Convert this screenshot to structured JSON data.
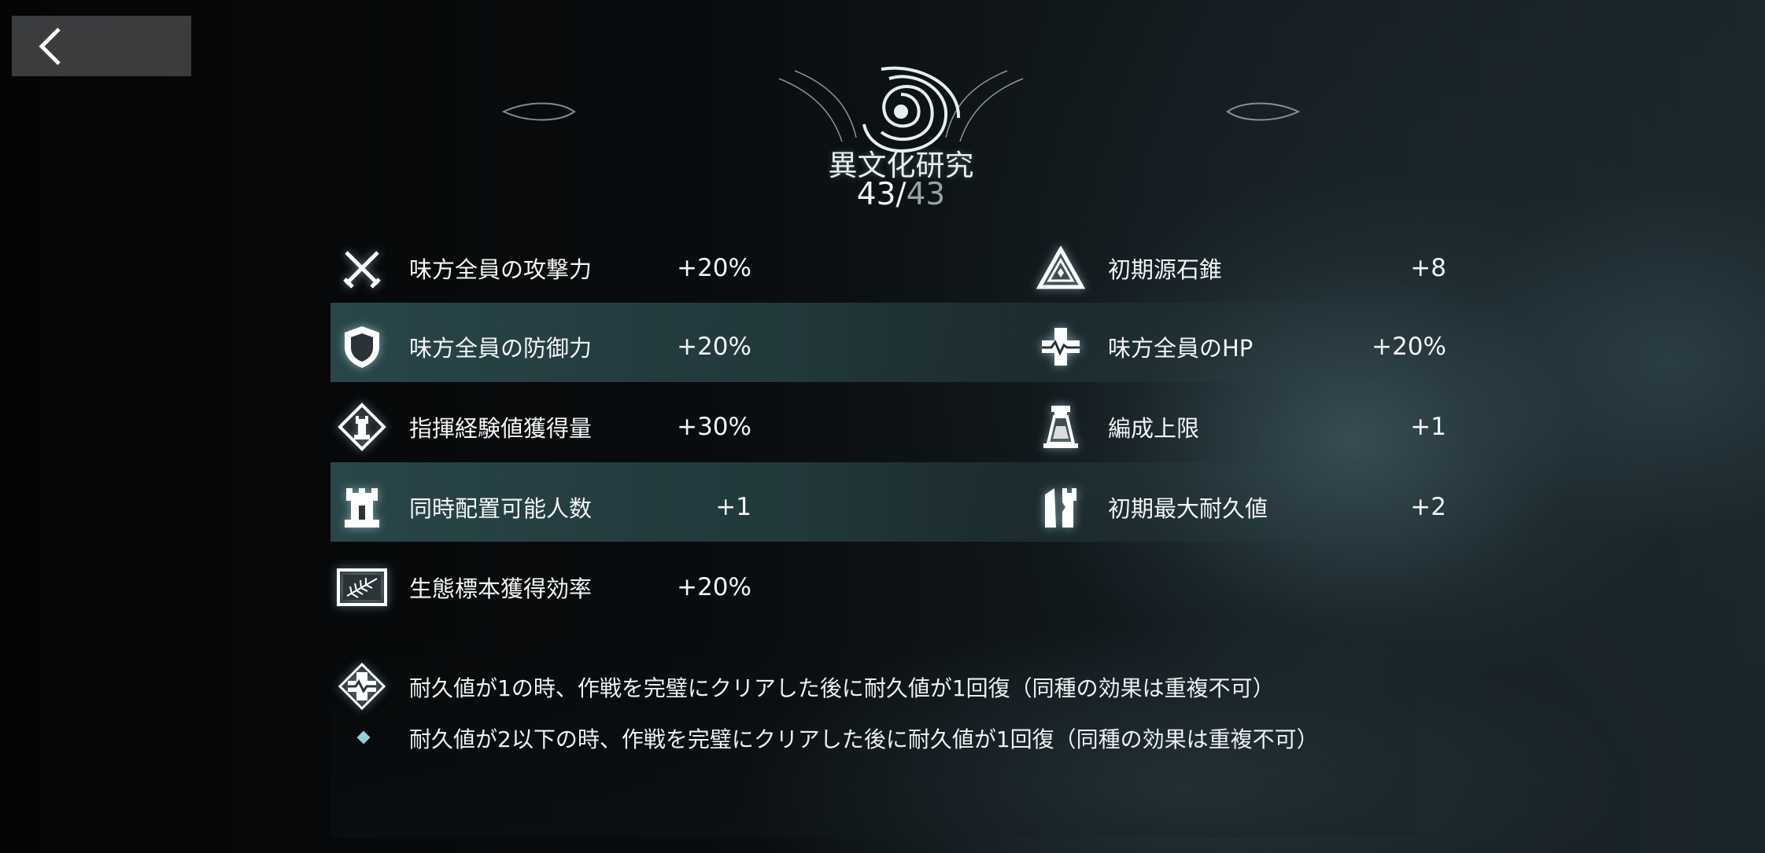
{
  "nav": {
    "back_icon": "chevron-left-icon"
  },
  "header": {
    "emblem_icon": "spiral-emblem-icon",
    "title": "異文化研究",
    "progress_current": "43/",
    "progress_total": "43"
  },
  "stats_left": [
    {
      "icon": "crossed-swords-icon",
      "label": "味方全員の攻撃力",
      "value": "+20%"
    },
    {
      "icon": "shield-icon",
      "label": "味方全員の防御力",
      "value": "+20%"
    },
    {
      "icon": "rook-diamond-icon",
      "label": "指揮経験値獲得量",
      "value": "+30%"
    },
    {
      "icon": "rook-icon",
      "label": "同時配置可能人数",
      "value": "+1"
    },
    {
      "icon": "fern-specimen-icon",
      "label": "生態標本獲得効率",
      "value": "+20%"
    }
  ],
  "stats_right": [
    {
      "icon": "triangle-crystal-icon",
      "label": "初期源石錐",
      "value": "+8"
    },
    {
      "icon": "medical-cross-icon",
      "label": "味方全員のHP",
      "value": "+20%"
    },
    {
      "icon": "lighthouse-icon",
      "label": "編成上限",
      "value": "+1"
    },
    {
      "icon": "broken-tower-icon",
      "label": "初期最大耐久値",
      "value": "+2"
    }
  ],
  "effects": [
    {
      "icon": "recovery-cross-icon",
      "text": "耐久値が1の時、作戦を完璧にクリアした後に耐久値が1回復（同種の効果は重複不可）"
    },
    {
      "icon": "diamond-bullet-icon",
      "text": "耐久値が2以下の時、作戦を完璧にクリアした後に耐久値が1回復（同種の効果は重複不可）"
    }
  ],
  "colors": {
    "accent": "#8fd3d6",
    "row_highlight": "#46787d",
    "back_button": "#3a3c3e"
  }
}
